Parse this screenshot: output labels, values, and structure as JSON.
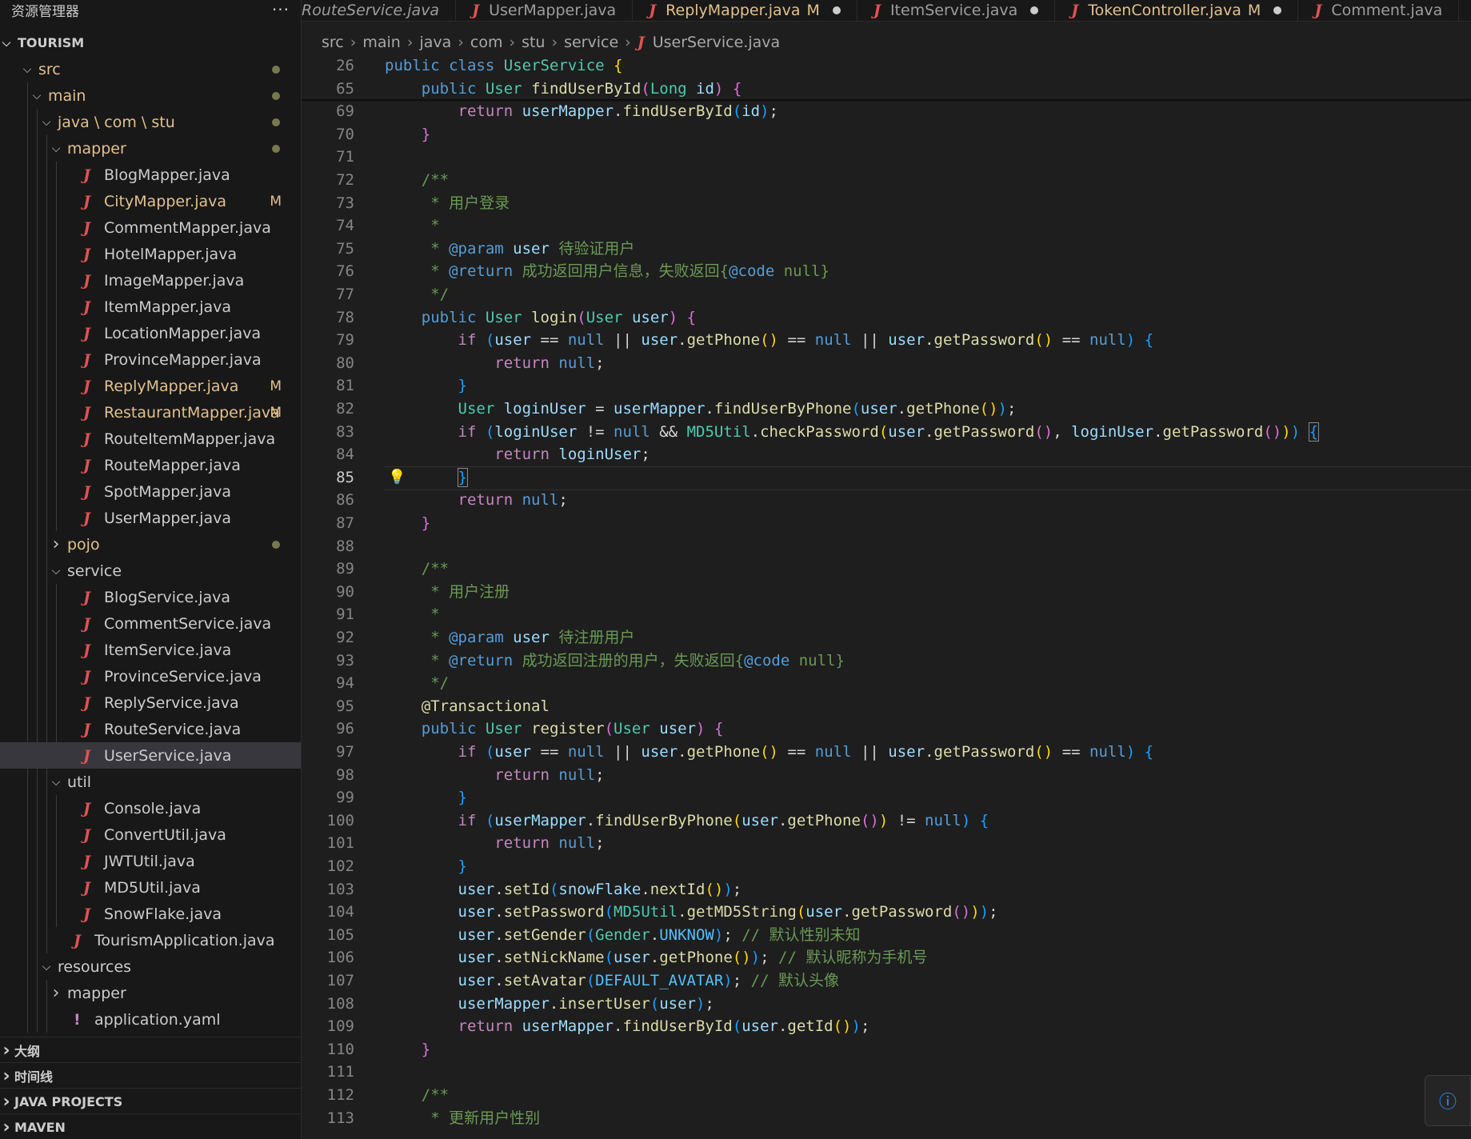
{
  "sidebar": {
    "title": "资源管理器",
    "more": "···",
    "tree": [
      {
        "label": "TOURISM",
        "depth": 0,
        "kind": "root",
        "chev": "v"
      },
      {
        "label": "src",
        "depth": 1,
        "kind": "folder",
        "chev": "v",
        "dot": true,
        "color": "y"
      },
      {
        "label": "main",
        "depth": 2,
        "kind": "folder",
        "chev": "v",
        "dot": true,
        "color": "y"
      },
      {
        "label": "java \\ com \\ stu",
        "depth": 3,
        "kind": "folder",
        "chev": "v",
        "dot": true,
        "color": "y"
      },
      {
        "label": "mapper",
        "depth": 4,
        "kind": "folder",
        "chev": "v",
        "dot": true,
        "color": "y"
      },
      {
        "label": "BlogMapper.java",
        "depth": 5,
        "kind": "java"
      },
      {
        "label": "CityMapper.java",
        "depth": 5,
        "kind": "java",
        "badge": "M"
      },
      {
        "label": "CommentMapper.java",
        "depth": 5,
        "kind": "java"
      },
      {
        "label": "HotelMapper.java",
        "depth": 5,
        "kind": "java"
      },
      {
        "label": "ImageMapper.java",
        "depth": 5,
        "kind": "java"
      },
      {
        "label": "ItemMapper.java",
        "depth": 5,
        "kind": "java"
      },
      {
        "label": "LocationMapper.java",
        "depth": 5,
        "kind": "java"
      },
      {
        "label": "ProvinceMapper.java",
        "depth": 5,
        "kind": "java"
      },
      {
        "label": "ReplyMapper.java",
        "depth": 5,
        "kind": "java",
        "badge": "M"
      },
      {
        "label": "RestaurantMapper.java",
        "depth": 5,
        "kind": "java",
        "badge": "M"
      },
      {
        "label": "RouteItemMapper.java",
        "depth": 5,
        "kind": "java"
      },
      {
        "label": "RouteMapper.java",
        "depth": 5,
        "kind": "java"
      },
      {
        "label": "SpotMapper.java",
        "depth": 5,
        "kind": "java"
      },
      {
        "label": "UserMapper.java",
        "depth": 5,
        "kind": "java"
      },
      {
        "label": "pojo",
        "depth": 4,
        "kind": "folder",
        "chev": ">",
        "dot": true,
        "color": "y"
      },
      {
        "label": "service",
        "depth": 4,
        "kind": "folder",
        "chev": "v"
      },
      {
        "label": "BlogService.java",
        "depth": 5,
        "kind": "java"
      },
      {
        "label": "CommentService.java",
        "depth": 5,
        "kind": "java"
      },
      {
        "label": "ItemService.java",
        "depth": 5,
        "kind": "java"
      },
      {
        "label": "ProvinceService.java",
        "depth": 5,
        "kind": "java"
      },
      {
        "label": "ReplyService.java",
        "depth": 5,
        "kind": "java"
      },
      {
        "label": "RouteService.java",
        "depth": 5,
        "kind": "java"
      },
      {
        "label": "UserService.java",
        "depth": 5,
        "kind": "java",
        "selected": true
      },
      {
        "label": "util",
        "depth": 4,
        "kind": "folder",
        "chev": "v"
      },
      {
        "label": "Console.java",
        "depth": 5,
        "kind": "java"
      },
      {
        "label": "ConvertUtil.java",
        "depth": 5,
        "kind": "java"
      },
      {
        "label": "JWTUtil.java",
        "depth": 5,
        "kind": "java"
      },
      {
        "label": "MD5Util.java",
        "depth": 5,
        "kind": "java"
      },
      {
        "label": "SnowFlake.java",
        "depth": 5,
        "kind": "java"
      },
      {
        "label": "TourismApplication.java",
        "depth": 4,
        "kind": "java"
      },
      {
        "label": "resources",
        "depth": 3,
        "kind": "folder",
        "chev": "v"
      },
      {
        "label": "mapper",
        "depth": 4,
        "kind": "folder",
        "chev": ">"
      },
      {
        "label": "application.yaml",
        "depth": 4,
        "kind": "yaml"
      }
    ],
    "sections": [
      "大纲",
      "时间线",
      "JAVA PROJECTS",
      "MAVEN"
    ]
  },
  "tabs": [
    {
      "label": "RouteService.java",
      "icon": false,
      "italic": true
    },
    {
      "label": "UserMapper.java"
    },
    {
      "label": "ReplyMapper.java",
      "modified": true,
      "flag": "M",
      "dot": true
    },
    {
      "label": "ItemService.java",
      "dot": true
    },
    {
      "label": "TokenController.java",
      "modified": true,
      "flag": "M",
      "dot": true
    },
    {
      "label": "Comment.java"
    },
    {
      "label": ""
    }
  ],
  "breadcrumb": [
    "src",
    "main",
    "java",
    "com",
    "stu",
    "service",
    "UserService.java"
  ],
  "editor": {
    "current_line": "85",
    "lines": [
      {
        "n": "26",
        "sticky": true,
        "h": "<span class='k'>public</span> <span class='k'>class</span> <span class='t'>UserService</span> <span class='p1'>{</span>"
      },
      {
        "n": "65",
        "sticky": true,
        "h": "    <span class='k'>public</span> <span class='t'>User</span> <span class='f'>findUserById</span><span class='p2'>(</span><span class='t'>Long</span> <span class='v'>id</span><span class='p2'>)</span> <span class='p2'>{</span>"
      },
      {
        "n": "69",
        "h": "        <span class='kc'>return</span> <span class='v'>userMapper</span>.<span class='f'>findUserById</span><span class='p3'>(</span><span class='v'>id</span><span class='p3'>)</span>;"
      },
      {
        "n": "70",
        "h": "    <span class='p2'>}</span>"
      },
      {
        "n": "71",
        "h": ""
      },
      {
        "n": "72",
        "h": "    <span class='c'>/**</span>"
      },
      {
        "n": "73",
        "h": "<span class='c'>     * 用户登录</span>"
      },
      {
        "n": "74",
        "h": "<span class='c'>     *</span>"
      },
      {
        "n": "75",
        "h": "<span class='c'>     * </span><span class='cd'>@param</span> <span class='v'>user</span><span class='c'> 待验证用户</span>"
      },
      {
        "n": "76",
        "h": "<span class='c'>     * </span><span class='cd'>@return</span><span class='c'> 成功返回用户信息，失败返回</span><span class='c'>{</span><span class='cd'>@code</span><span class='c'> null}</span>"
      },
      {
        "n": "77",
        "h": "<span class='c'>     */</span>"
      },
      {
        "n": "78",
        "h": "    <span class='k'>public</span> <span class='t'>User</span> <span class='f'>login</span><span class='p2'>(</span><span class='t'>User</span> <span class='v'>user</span><span class='p2'>)</span> <span class='p2'>{</span>"
      },
      {
        "n": "79",
        "h": "        <span class='kc'>if</span> <span class='p3'>(</span><span class='v'>user</span> == <span class='k'>null</span> || <span class='v'>user</span>.<span class='f'>getPhone</span><span class='p1'>()</span> == <span class='k'>null</span> || <span class='v'>user</span>.<span class='f'>getPassword</span><span class='p1'>()</span> == <span class='k'>null</span><span class='p3'>)</span> <span class='p3'>{</span>"
      },
      {
        "n": "80",
        "h": "            <span class='kc'>return</span> <span class='k'>null</span>;"
      },
      {
        "n": "81",
        "h": "        <span class='p3'>}</span>"
      },
      {
        "n": "82",
        "h": "        <span class='t'>User</span> <span class='v'>loginUser</span> = <span class='v'>userMapper</span>.<span class='f'>findUserByPhone</span><span class='p3'>(</span><span class='v'>user</span>.<span class='f'>getPhone</span><span class='p1'>()</span><span class='p3'>)</span>;"
      },
      {
        "n": "83",
        "h": "        <span class='kc'>if</span> <span class='p3'>(</span><span class='v'>loginUser</span> != <span class='k'>null</span> &amp;&amp; <span class='t'>MD5Util</span>.<span class='f'>checkPassword</span><span class='p1'>(</span><span class='v'>user</span>.<span class='f'>getPassword</span><span class='p2'>()</span>, <span class='v'>loginUser</span>.<span class='f'>getPassword</span><span class='p2'>()</span><span class='p1'>)</span><span class='p3'>)</span> <span class='p3' style='outline:1px solid #888'>{</span>"
      },
      {
        "n": "84",
        "h": "            <span class='kc'>return</span> <span class='v'>loginUser</span>;"
      },
      {
        "n": "85",
        "cur": true,
        "bulb": true,
        "h": "        <span class='p3' style='outline:1px solid #888'>}</span>"
      },
      {
        "n": "86",
        "h": "        <span class='kc'>return</span> <span class='k'>null</span>;"
      },
      {
        "n": "87",
        "h": "    <span class='p2'>}</span>"
      },
      {
        "n": "88",
        "h": ""
      },
      {
        "n": "89",
        "h": "    <span class='c'>/**</span>"
      },
      {
        "n": "90",
        "h": "<span class='c'>     * 用户注册</span>"
      },
      {
        "n": "91",
        "h": "<span class='c'>     *</span>"
      },
      {
        "n": "92",
        "h": "<span class='c'>     * </span><span class='cd'>@param</span> <span class='v'>user</span><span class='c'> 待注册用户</span>"
      },
      {
        "n": "93",
        "h": "<span class='c'>     * </span><span class='cd'>@return</span><span class='c'> 成功返回注册的用户，失败返回</span><span class='c'>{</span><span class='cd'>@code</span><span class='c'> null}</span>"
      },
      {
        "n": "94",
        "h": "<span class='c'>     */</span>"
      },
      {
        "n": "95",
        "h": "    <span class='ann'>@Transactional</span>"
      },
      {
        "n": "96",
        "h": "    <span class='k'>public</span> <span class='t'>User</span> <span class='f'>register</span><span class='p2'>(</span><span class='t'>User</span> <span class='v'>user</span><span class='p2'>)</span> <span class='p2'>{</span>"
      },
      {
        "n": "97",
        "h": "        <span class='kc'>if</span> <span class='p3'>(</span><span class='v'>user</span> == <span class='k'>null</span> || <span class='v'>user</span>.<span class='f'>getPhone</span><span class='p1'>()</span> == <span class='k'>null</span> || <span class='v'>user</span>.<span class='f'>getPassword</span><span class='p1'>()</span> == <span class='k'>null</span><span class='p3'>)</span> <span class='p3'>{</span>"
      },
      {
        "n": "98",
        "h": "            <span class='kc'>return</span> <span class='k'>null</span>;"
      },
      {
        "n": "99",
        "h": "        <span class='p3'>}</span>"
      },
      {
        "n": "100",
        "h": "        <span class='kc'>if</span> <span class='p3'>(</span><span class='v'>userMapper</span>.<span class='f'>findUserByPhone</span><span class='p1'>(</span><span class='v'>user</span>.<span class='f'>getPhone</span><span class='p2'>()</span><span class='p1'>)</span> != <span class='k'>null</span><span class='p3'>)</span> <span class='p3'>{</span>"
      },
      {
        "n": "101",
        "h": "            <span class='kc'>return</span> <span class='k'>null</span>;"
      },
      {
        "n": "102",
        "h": "        <span class='p3'>}</span>"
      },
      {
        "n": "103",
        "h": "        <span class='v'>user</span>.<span class='f'>setId</span><span class='p3'>(</span><span class='v'>snowFlake</span>.<span class='f'>nextId</span><span class='p1'>()</span><span class='p3'>)</span>;"
      },
      {
        "n": "104",
        "h": "        <span class='v'>user</span>.<span class='f'>setPassword</span><span class='p3'>(</span><span class='t'>MD5Util</span>.<span class='f'>getMD5String</span><span class='p1'>(</span><span class='v'>user</span>.<span class='f'>getPassword</span><span class='p2'>()</span><span class='p1'>)</span><span class='p3'>)</span>;"
      },
      {
        "n": "105",
        "h": "        <span class='v'>user</span>.<span class='f'>setGender</span><span class='p3'>(</span><span class='t'>Gender</span>.<span class='const'>UNKNOW</span><span class='p3'>)</span>; <span class='c'>// 默认性别未知</span>"
      },
      {
        "n": "106",
        "h": "        <span class='v'>user</span>.<span class='f'>setNickName</span><span class='p3'>(</span><span class='v'>user</span>.<span class='f'>getPhone</span><span class='p1'>()</span><span class='p3'>)</span>; <span class='c'>// 默认昵称为手机号</span>"
      },
      {
        "n": "107",
        "h": "        <span class='v'>user</span>.<span class='f'>setAvatar</span><span class='p3'>(</span><span class='const'>DEFAULT_AVATAR</span><span class='p3'>)</span>; <span class='c'>// 默认头像</span>"
      },
      {
        "n": "108",
        "h": "        <span class='v'>userMapper</span>.<span class='f'>insertUser</span><span class='p3'>(</span><span class='v'>user</span><span class='p3'>)</span>;"
      },
      {
        "n": "109",
        "h": "        <span class='kc'>return</span> <span class='v'>userMapper</span>.<span class='f'>findUserById</span><span class='p3'>(</span><span class='v'>user</span>.<span class='f'>getId</span><span class='p1'>()</span><span class='p3'>)</span>;"
      },
      {
        "n": "110",
        "h": "    <span class='p2'>}</span>"
      },
      {
        "n": "111",
        "h": ""
      },
      {
        "n": "112",
        "h": "    <span class='c'>/**</span>"
      },
      {
        "n": "113",
        "h": "<span class='c'>     * 更新用户性别</span>"
      }
    ]
  },
  "notification": {
    "icon": "info-icon",
    "label": "ⓘ"
  },
  "colors": {
    "background": "#1e1e1e",
    "sidebar": "#181818",
    "accent": "#3794ff",
    "modified": "#e2c08d",
    "java_icon": "#e05252"
  }
}
